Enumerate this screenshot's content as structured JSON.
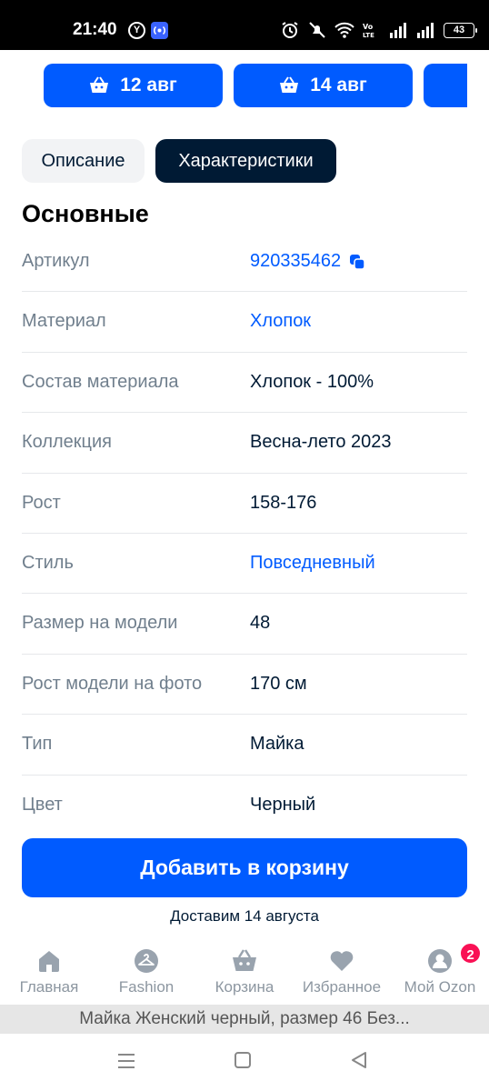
{
  "status_bar": {
    "time": "21:40",
    "y_icon": "Y",
    "icons": [
      "alarm-icon",
      "mute-icon",
      "wifi-icon",
      "volte-icon",
      "signal-icon",
      "signal-icon"
    ],
    "battery": "43"
  },
  "dates": [
    {
      "icon": "basket-icon",
      "label": "12 авг"
    },
    {
      "icon": "basket-icon",
      "label": "14 авг"
    }
  ],
  "tabs": [
    {
      "label": "Описание",
      "active": false
    },
    {
      "label": "Характеристики",
      "active": true
    }
  ],
  "section": {
    "title": "Основные"
  },
  "specs": [
    {
      "key": "Артикул",
      "value": "920335462",
      "link": true,
      "copy": true
    },
    {
      "key": "Материал",
      "value": "Хлопок",
      "link": true
    },
    {
      "key": "Состав материала",
      "value": "Хлопок - 100%",
      "link": false
    },
    {
      "key": "Коллекция",
      "value": "Весна-лето 2023",
      "link": false
    },
    {
      "key": "Рост",
      "value": "158-176",
      "link": false
    },
    {
      "key": "Стиль",
      "value": "Повседневный",
      "link": true
    },
    {
      "key": "Размер на модели",
      "value": "48",
      "link": false
    },
    {
      "key": "Рост модели на фото",
      "value": "170 см",
      "link": false
    },
    {
      "key": "Тип",
      "value": "Майка",
      "link": false
    },
    {
      "key": "Цвет",
      "value": "Черный",
      "link": false
    }
  ],
  "cart": {
    "button_label": "Добавить в корзину",
    "delivery_note": "Доставим 14 августа"
  },
  "bottom_nav": [
    {
      "icon": "home-icon",
      "label": "Главная"
    },
    {
      "icon": "hanger-icon",
      "label": "Fashion"
    },
    {
      "icon": "basket-icon",
      "label": "Корзина"
    },
    {
      "icon": "heart-icon",
      "label": "Избранное"
    },
    {
      "icon": "profile-icon",
      "label": "Мой Ozon",
      "badge": "2"
    }
  ],
  "page_title": "Майка Женский черный, размер 46 Без...",
  "colors": {
    "accent": "#005bff",
    "dark": "#001a34",
    "muted": "#707f8d",
    "badge": "#f91155"
  }
}
